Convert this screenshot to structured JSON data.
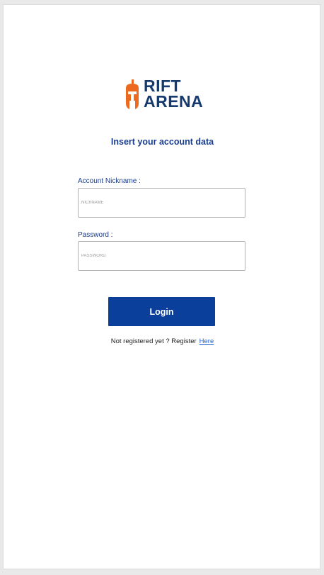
{
  "brand": {
    "line1": "RIFT",
    "line2": "ARENA",
    "logo_icon": "spartan-helmet-icon",
    "colors": {
      "brand_dark": "#163a6e",
      "brand_orange": "#ec6a1f"
    }
  },
  "form": {
    "heading": "Insert your account data",
    "nickname": {
      "label": "Account Nickname :",
      "placeholder": "NICKNAME",
      "value": ""
    },
    "password": {
      "label": "Password :",
      "placeholder": "PASSWORD",
      "value": ""
    },
    "login_label": "Login"
  },
  "register": {
    "prompt": "Not registered yet ? Register",
    "link_label": "Here"
  },
  "colors": {
    "accent": "#0a3f9c",
    "label_text": "#1a3c8c",
    "link": "#1a5fd0"
  }
}
